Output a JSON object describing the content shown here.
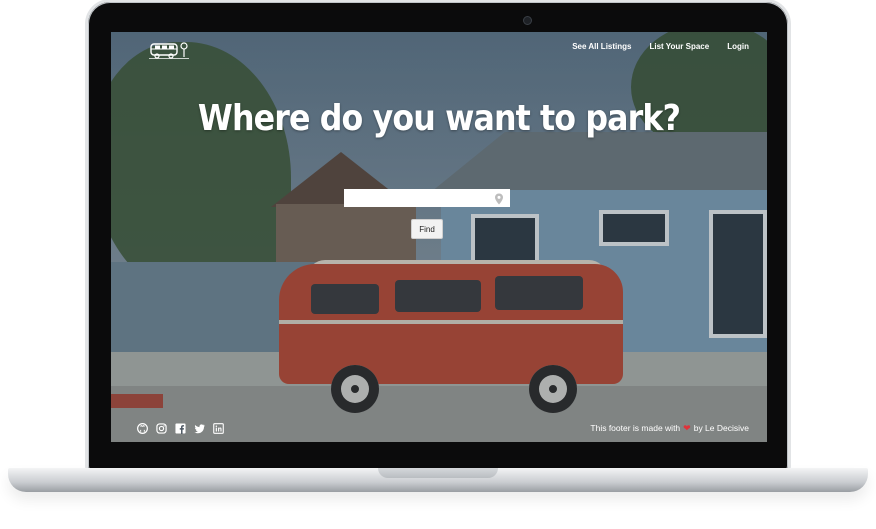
{
  "header": {
    "logo_icon": "van-logo-icon",
    "nav": [
      {
        "label": "See All Listings"
      },
      {
        "label": "List Your Space"
      },
      {
        "label": "Login"
      }
    ]
  },
  "hero": {
    "title": "Where do you want to park?",
    "search": {
      "value": "",
      "placeholder": "",
      "icon": "map-pin-icon"
    },
    "find_label": "Find"
  },
  "footer": {
    "social_icons": [
      "github-icon",
      "instagram-icon",
      "facebook-icon",
      "twitter-icon",
      "linkedin-icon"
    ],
    "text_before": "This footer is made with",
    "heart_icon": "heart-icon",
    "text_after": "by Le Decisive",
    "heart_color": "#e0323a"
  }
}
